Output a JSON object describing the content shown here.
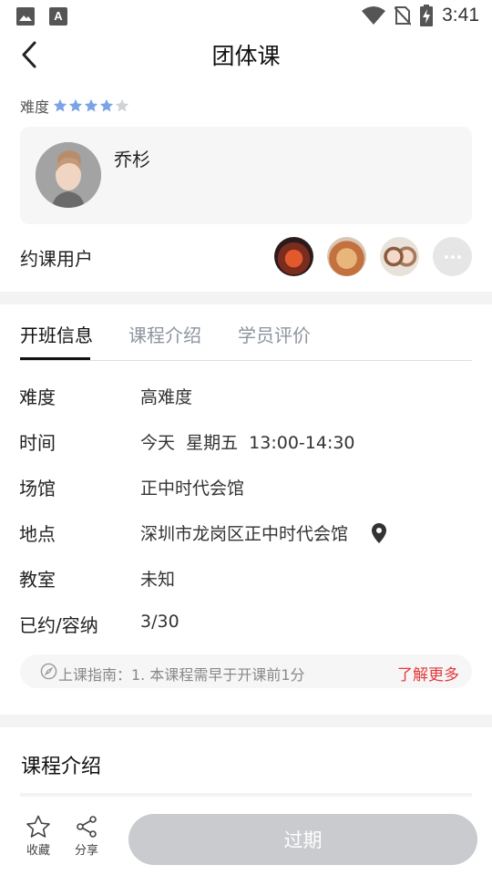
{
  "status_bar": {
    "time": "3:41",
    "left_icons": [
      "image-icon",
      "font-a-icon"
    ],
    "right_icons": [
      "wifi-icon",
      "no-sim-icon",
      "battery-charging-icon"
    ]
  },
  "header": {
    "title": "团体课",
    "back_icon": "chevron-left-icon"
  },
  "difficulty": {
    "label": "难度",
    "rating": 4,
    "max": 5,
    "star_color": "#7aa3e8",
    "star_empty_color": "#cfd3d8"
  },
  "coach": {
    "name": "乔杉"
  },
  "booked_users": {
    "label": "约课用户",
    "more_icon": "more-dots-icon"
  },
  "tabs": [
    {
      "label": "开班信息",
      "active": true
    },
    {
      "label": "课程介绍",
      "active": false
    },
    {
      "label": "学员评价",
      "active": false
    }
  ],
  "info": {
    "difficulty": {
      "label": "难度",
      "value": "高难度"
    },
    "time": {
      "label": "时间",
      "value": "今天  星期五  13:00-14:30"
    },
    "venue": {
      "label": "场馆",
      "value": "正中时代会馆"
    },
    "location": {
      "label": "地点",
      "value": "深圳市龙岗区正中时代会馆",
      "icon": "location-pin-icon"
    },
    "classroom": {
      "label": "教室",
      "value": "未知"
    },
    "capacity": {
      "label": "已约/容纳",
      "value": "3/30"
    }
  },
  "guide": {
    "text": "上课指南：1. 本课程需早于开课前1分",
    "more": "了解更多",
    "more_color": "#e4393c",
    "icon": "compass-icon"
  },
  "intro": {
    "title": "课程介绍"
  },
  "bottom_bar": {
    "favorite_label": "收藏",
    "share_label": "分享",
    "action_label": "过期",
    "action_color": "#c9cbcf"
  }
}
